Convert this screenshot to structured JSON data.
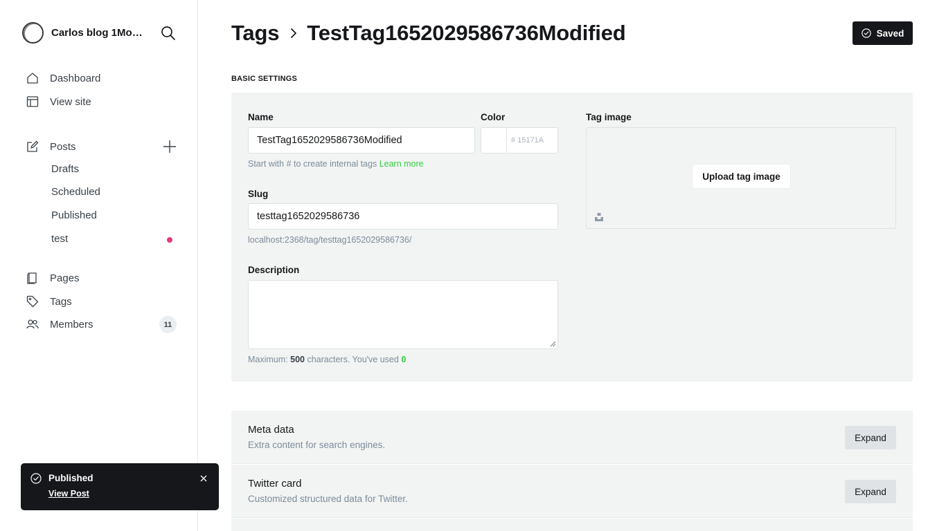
{
  "sidebar": {
    "site_name": "Carlos blog 1Modified",
    "nav": {
      "dashboard": "Dashboard",
      "view_site": "View site",
      "posts": "Posts",
      "drafts": "Drafts",
      "scheduled": "Scheduled",
      "published": "Published",
      "test": "test",
      "pages": "Pages",
      "tags": "Tags",
      "members": "Members",
      "members_count": "11"
    },
    "accent_colors": {
      "test_dot": "#e5387d"
    }
  },
  "toast": {
    "title": "Published",
    "link": "View Post"
  },
  "header": {
    "breadcrumb_parent": "Tags",
    "title": "TestTag1652029586736Modified",
    "saved_label": "Saved"
  },
  "basic_settings": {
    "section_title": "BASIC SETTINGS",
    "name_label": "Name",
    "name_value": "TestTag1652029586736Modified",
    "name_hint": "Start with # to create internal tags",
    "name_hint_link": "Learn more",
    "color_label": "Color",
    "color_placeholder": "# 15171A",
    "slug_label": "Slug",
    "slug_value": "testtag1652029586736",
    "slug_url": "localhost:2368/tag/testtag1652029586736/",
    "tag_image_label": "Tag image",
    "upload_label": "Upload tag image",
    "description_label": "Description",
    "desc_hint_prefix": "Maximum:",
    "desc_max": "500",
    "desc_hint_mid": "characters. You've used",
    "desc_used": "0"
  },
  "accordions": [
    {
      "title": "Meta data",
      "description": "Extra content for search engines.",
      "button": "Expand"
    },
    {
      "title": "Twitter card",
      "description": "Customized structured data for Twitter.",
      "button": "Expand"
    }
  ]
}
